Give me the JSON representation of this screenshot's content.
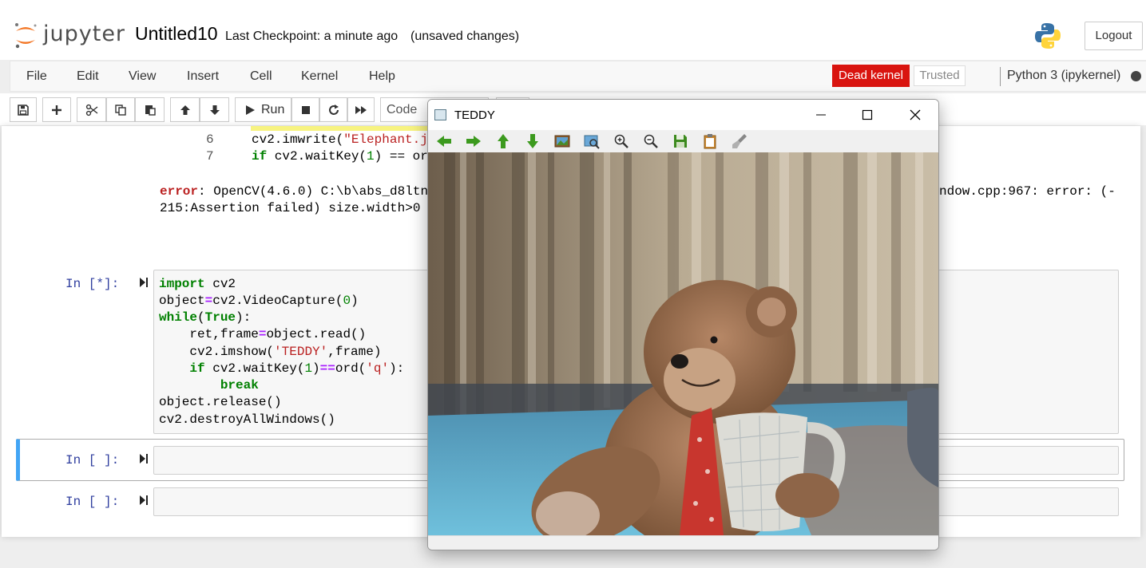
{
  "header": {
    "logo_text": "jupyter",
    "notebook_title": "Untitled10",
    "checkpoint": "Last Checkpoint: a minute ago",
    "unsaved": "(unsaved changes)",
    "logout_label": "Logout"
  },
  "menubar": {
    "items": [
      "File",
      "Edit",
      "View",
      "Insert",
      "Cell",
      "Kernel",
      "Help"
    ],
    "dead_kernel": "Dead kernel",
    "trusted": "Trusted",
    "kernel_name": "Python 3 (ipykernel)"
  },
  "toolbar": {
    "run_label": "Run",
    "cell_type": "Code"
  },
  "cells": {
    "prev_output": {
      "lines": [
        {
          "no": "6",
          "code_a": "cv2.imwrite(",
          "code_str": "\"Elephant.j"
        },
        {
          "no": "7",
          "code_a": "if",
          "code_b": " cv2.waitKey(",
          "code_num": "1",
          "code_c": ") == or"
        }
      ],
      "error_label": "error",
      "error_line1_a": ": OpenCV(4.6.0) C:\\b\\abs_d8ltn",
      "error_line1_b": "ndow.cpp:967: error: (-",
      "error_line2": "215:Assertion failed) size.width>0"
    },
    "running_prompt": "In [*]:",
    "empty_prompt_1": "In [ ]:",
    "empty_prompt_2": "In [ ]:"
  },
  "teddy_window": {
    "title": "TEDDY"
  },
  "colors": {
    "dead_kernel": "#d9140f",
    "prompt": "#303f9f",
    "selected_border": "#42a5f5",
    "keyword": "#008000",
    "operator": "#aa22ff",
    "string": "#ba2121"
  }
}
